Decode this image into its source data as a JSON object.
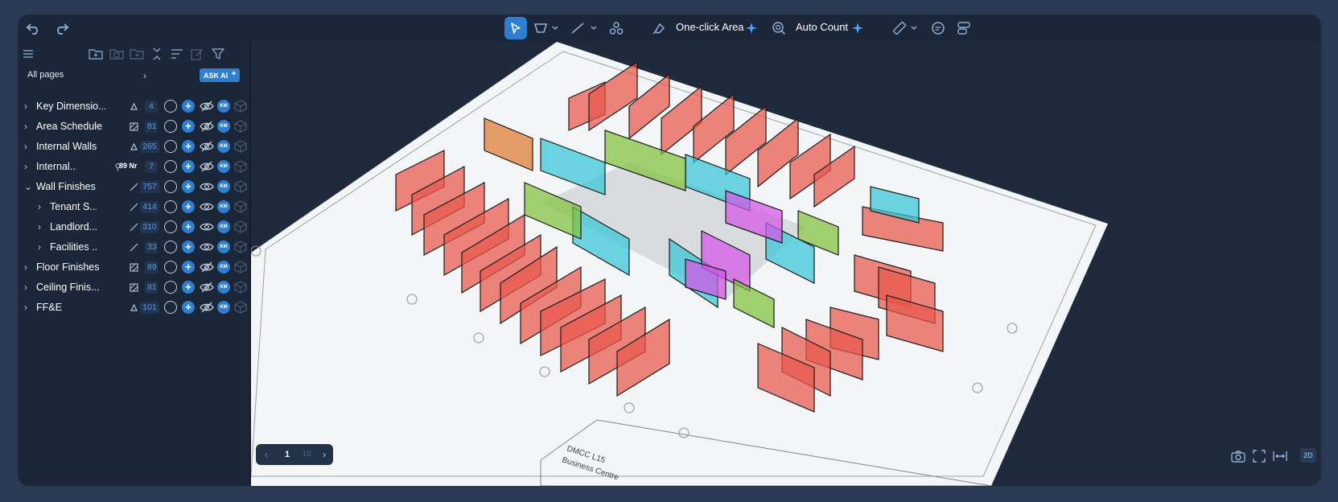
{
  "toolbar": {
    "one_click_area_label": "One-click Area",
    "auto_count_label": "Auto Count"
  },
  "sidebar": {
    "pages_label": "All pages",
    "ask_ai_label": "ASK AI",
    "rows": [
      {
        "label": "Key Dimensio...",
        "count": "4",
        "level": 0,
        "expanded": false,
        "visible": false,
        "type_icon": "area-fill-icon"
      },
      {
        "label": "Area Schedule",
        "count": "81",
        "level": 0,
        "expanded": false,
        "visible": false,
        "type_icon": "hatch-area-icon"
      },
      {
        "label": "Internal Walls",
        "count": "265",
        "level": 0,
        "expanded": false,
        "visible": false,
        "type_icon": "area-fill-icon"
      },
      {
        "label": "Internal...",
        "count": "7",
        "extra": "89 Nr",
        "level": 0,
        "expanded": false,
        "visible": false,
        "type_icon": "count-pin-icon"
      },
      {
        "label": "Wall Finishes",
        "count": "757",
        "level": 0,
        "expanded": true,
        "visible": true,
        "type_icon": "line-icon"
      },
      {
        "label": "Tenant S...",
        "count": "414",
        "level": 1,
        "expanded": false,
        "visible": true,
        "type_icon": "line-icon"
      },
      {
        "label": "Landlord...",
        "count": "310",
        "level": 1,
        "expanded": false,
        "visible": true,
        "type_icon": "line-icon"
      },
      {
        "label": "Facilities ...",
        "count": "33",
        "level": 1,
        "expanded": false,
        "visible": true,
        "type_icon": "line-icon"
      },
      {
        "label": "Floor Finishes",
        "count": "89",
        "level": 0,
        "expanded": false,
        "visible": false,
        "type_icon": "hatch-area-icon"
      },
      {
        "label": "Ceiling Finis...",
        "count": "81",
        "level": 0,
        "expanded": false,
        "visible": false,
        "type_icon": "hatch-area-icon"
      },
      {
        "label": "FF&E",
        "count": "101",
        "level": 0,
        "expanded": false,
        "visible": false,
        "type_icon": "area-fill-icon"
      }
    ]
  },
  "drawing": {
    "title_lines": [
      "DMCC L15",
      "Business Centre"
    ]
  },
  "pager": {
    "current": "1",
    "total": "15"
  },
  "view_mode_label": "2D",
  "colors": {
    "accent": "#2f7fd1",
    "background": "#1b2638",
    "wall_red": "#e8574b",
    "wall_cyan": "#35c6d6",
    "wall_magenta": "#d455e8",
    "wall_green": "#7fc23a",
    "wall_orange": "#e07a2e"
  }
}
